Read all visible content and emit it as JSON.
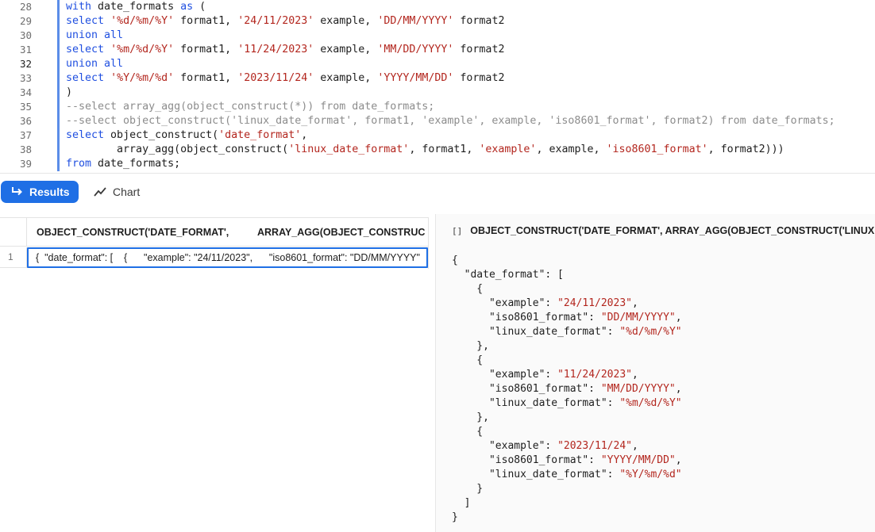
{
  "editor": {
    "lines": [
      {
        "num": "28",
        "parts": [
          {
            "t": "with",
            "c": "kw"
          },
          {
            "t": " date_formats ",
            "c": ""
          },
          {
            "t": "as",
            "c": "kw"
          },
          {
            "t": " (",
            "c": ""
          }
        ]
      },
      {
        "num": "29",
        "parts": [
          {
            "t": "select",
            "c": "kw"
          },
          {
            "t": " ",
            "c": ""
          },
          {
            "t": "'%d/%m/%Y'",
            "c": "str"
          },
          {
            "t": " format1, ",
            "c": ""
          },
          {
            "t": "'24/11/2023'",
            "c": "str"
          },
          {
            "t": " example, ",
            "c": ""
          },
          {
            "t": "'DD/MM/YYYY'",
            "c": "str"
          },
          {
            "t": " format2",
            "c": ""
          }
        ]
      },
      {
        "num": "30",
        "parts": [
          {
            "t": "union all",
            "c": "kw"
          }
        ]
      },
      {
        "num": "31",
        "parts": [
          {
            "t": "select",
            "c": "kw"
          },
          {
            "t": " ",
            "c": ""
          },
          {
            "t": "'%m/%d/%Y'",
            "c": "str"
          },
          {
            "t": " format1, ",
            "c": ""
          },
          {
            "t": "'11/24/2023'",
            "c": "str"
          },
          {
            "t": " example, ",
            "c": ""
          },
          {
            "t": "'MM/DD/YYYY'",
            "c": "str"
          },
          {
            "t": " format2",
            "c": ""
          }
        ]
      },
      {
        "num": "32",
        "current": true,
        "parts": [
          {
            "t": "union all",
            "c": "kw"
          }
        ]
      },
      {
        "num": "33",
        "parts": [
          {
            "t": "select",
            "c": "kw"
          },
          {
            "t": " ",
            "c": ""
          },
          {
            "t": "'%Y/%m/%d'",
            "c": "str"
          },
          {
            "t": " format1, ",
            "c": ""
          },
          {
            "t": "'2023/11/24'",
            "c": "str"
          },
          {
            "t": " example, ",
            "c": ""
          },
          {
            "t": "'YYYY/MM/DD'",
            "c": "str"
          },
          {
            "t": " format2",
            "c": ""
          }
        ]
      },
      {
        "num": "34",
        "parts": [
          {
            "t": ")",
            "c": ""
          }
        ]
      },
      {
        "num": "35",
        "parts": [
          {
            "t": "--select array_agg(object_construct(*)) from date_formats;",
            "c": "cm"
          }
        ]
      },
      {
        "num": "36",
        "parts": [
          {
            "t": "--select object_construct('linux_date_format', format1, 'example', example, 'iso8601_format', format2) from date_formats;",
            "c": "cm"
          }
        ]
      },
      {
        "num": "37",
        "parts": [
          {
            "t": "select",
            "c": "kw"
          },
          {
            "t": " object_construct(",
            "c": ""
          },
          {
            "t": "'date_format'",
            "c": "str"
          },
          {
            "t": ",",
            "c": ""
          }
        ]
      },
      {
        "num": "38",
        "parts": [
          {
            "t": "        array_agg(object_construct(",
            "c": ""
          },
          {
            "t": "'linux_date_format'",
            "c": "str"
          },
          {
            "t": ", format1, ",
            "c": ""
          },
          {
            "t": "'example'",
            "c": "str"
          },
          {
            "t": ", example, ",
            "c": ""
          },
          {
            "t": "'iso8601_format'",
            "c": "str"
          },
          {
            "t": ", format2)))",
            "c": ""
          }
        ]
      },
      {
        "num": "39",
        "parts": [
          {
            "t": "from",
            "c": "kw"
          },
          {
            "t": " date_formats;",
            "c": ""
          }
        ]
      }
    ]
  },
  "toolbar": {
    "results_label": "Results",
    "chart_label": "Chart"
  },
  "grid": {
    "columns": [
      "OBJECT_CONSTRUCT('DATE_FORMAT',",
      "ARRAY_AGG(OBJECT_CONSTRUC"
    ],
    "rows": [
      {
        "num": "1",
        "value": "{  \"date_format\": [    {      \"example\": \"24/11/2023\",      \"iso8601_format\": \"DD/MM/YYYY\""
      }
    ]
  },
  "detail": {
    "icon": "[]",
    "title": "OBJECT_CONSTRUCT('DATE_FORMAT', ARRAY_AGG(OBJECT_CONSTRUCT('LINUX",
    "json_lines": [
      [
        {
          "t": "{",
          "c": ""
        }
      ],
      [
        {
          "t": "  \"date_format\": [",
          "c": ""
        }
      ],
      [
        {
          "t": "    {",
          "c": ""
        }
      ],
      [
        {
          "t": "      \"example\": ",
          "c": ""
        },
        {
          "t": "\"24/11/2023\"",
          "c": "json-str"
        },
        {
          "t": ",",
          "c": ""
        }
      ],
      [
        {
          "t": "      \"iso8601_format\": ",
          "c": ""
        },
        {
          "t": "\"DD/MM/YYYY\"",
          "c": "json-str"
        },
        {
          "t": ",",
          "c": ""
        }
      ],
      [
        {
          "t": "      \"linux_date_format\": ",
          "c": ""
        },
        {
          "t": "\"%d/%m/%Y\"",
          "c": "json-str"
        }
      ],
      [
        {
          "t": "    },",
          "c": ""
        }
      ],
      [
        {
          "t": "    {",
          "c": ""
        }
      ],
      [
        {
          "t": "      \"example\": ",
          "c": ""
        },
        {
          "t": "\"11/24/2023\"",
          "c": "json-str"
        },
        {
          "t": ",",
          "c": ""
        }
      ],
      [
        {
          "t": "      \"iso8601_format\": ",
          "c": ""
        },
        {
          "t": "\"MM/DD/YYYY\"",
          "c": "json-str"
        },
        {
          "t": ",",
          "c": ""
        }
      ],
      [
        {
          "t": "      \"linux_date_format\": ",
          "c": ""
        },
        {
          "t": "\"%m/%d/%Y\"",
          "c": "json-str"
        }
      ],
      [
        {
          "t": "    },",
          "c": ""
        }
      ],
      [
        {
          "t": "    {",
          "c": ""
        }
      ],
      [
        {
          "t": "      \"example\": ",
          "c": ""
        },
        {
          "t": "\"2023/11/24\"",
          "c": "json-str"
        },
        {
          "t": ",",
          "c": ""
        }
      ],
      [
        {
          "t": "      \"iso8601_format\": ",
          "c": ""
        },
        {
          "t": "\"YYYY/MM/DD\"",
          "c": "json-str"
        },
        {
          "t": ",",
          "c": ""
        }
      ],
      [
        {
          "t": "      \"linux_date_format\": ",
          "c": ""
        },
        {
          "t": "\"%Y/%m/%d\"",
          "c": "json-str"
        }
      ],
      [
        {
          "t": "    }",
          "c": ""
        }
      ],
      [
        {
          "t": "  ]",
          "c": ""
        }
      ],
      [
        {
          "t": "}",
          "c": ""
        }
      ]
    ]
  },
  "colors": {
    "accent": "#1f6fe5",
    "keyword": "#1f4fe0",
    "string": "#b3261e",
    "comment": "#8c8c8c"
  }
}
